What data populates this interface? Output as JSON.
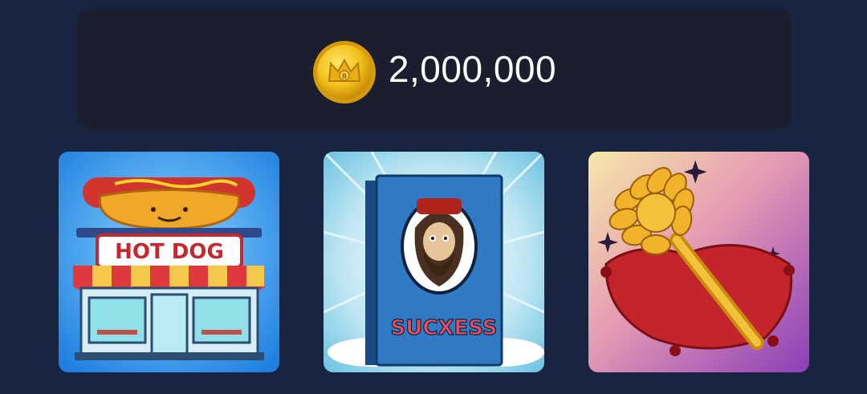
{
  "balance": {
    "amount": "2,000,000",
    "currency_icon": "gold-crown-coin"
  },
  "items": [
    {
      "name": "hot-dog-stand",
      "sign_text": "HOT DOG",
      "icon": "hot-dog-shop"
    },
    {
      "name": "success-book",
      "cover_text": "SUCXESS",
      "icon": "book-with-bearded-man"
    },
    {
      "name": "golden-toilet-brush",
      "icon": "brush-on-red-pillow"
    }
  ],
  "colors": {
    "background": "#192440",
    "panel": "#1b1e2e",
    "coin_gold": "#f2c21b"
  }
}
